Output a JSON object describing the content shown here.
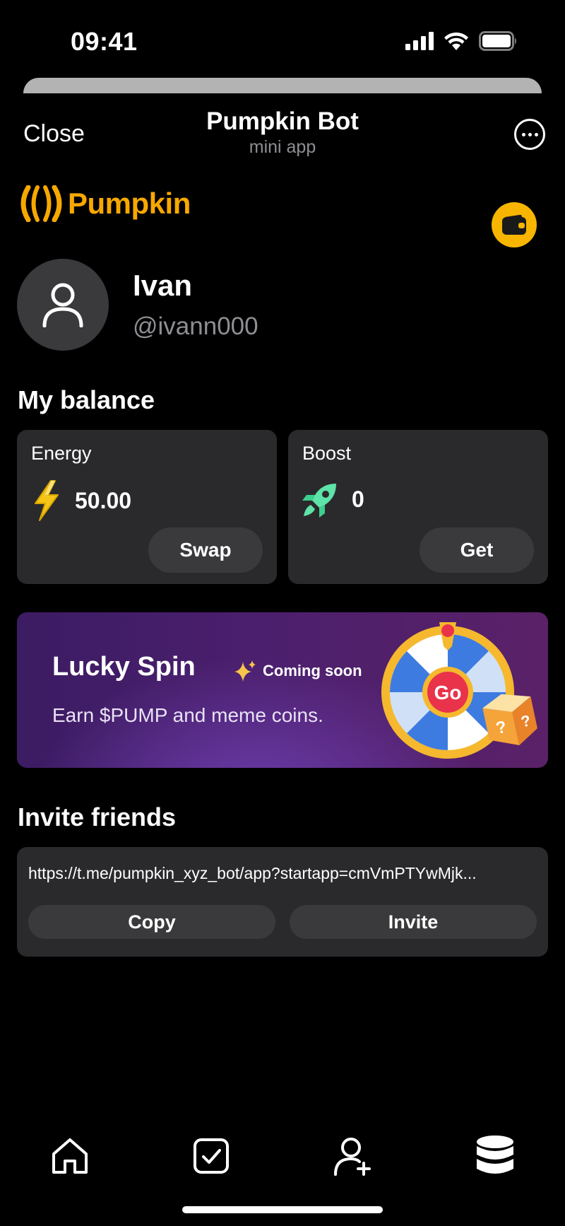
{
  "status_bar": {
    "time": "09:41"
  },
  "header": {
    "close_label": "Close",
    "title": "Pumpkin Bot",
    "subtitle": "mini app"
  },
  "brand": {
    "name": "Pumpkin",
    "color": "#F7A800"
  },
  "profile": {
    "name": "Ivan",
    "username": "@ivann000"
  },
  "balance": {
    "section_title": "My balance",
    "energy": {
      "label": "Energy",
      "value": "50.00",
      "button": "Swap",
      "icon": "lightning-icon"
    },
    "boost": {
      "label": "Boost",
      "value": "0",
      "button": "Get",
      "icon": "rocket-icon"
    }
  },
  "lucky_spin": {
    "title": "Lucky Spin",
    "badge": "Coming soon",
    "subtitle": "Earn $PUMP and meme coins.",
    "wheel_center_label": "Go",
    "dice_glyph": "?"
  },
  "invite": {
    "section_title": "Invite friends",
    "link": "https://t.me/pumpkin_xyz_bot/app?startapp=cmVmPTYwMjk...",
    "copy_label": "Copy",
    "invite_label": "Invite"
  },
  "tabbar": {
    "items": [
      "home-icon",
      "tasks-icon",
      "add-friend-icon",
      "coins-icon"
    ]
  }
}
